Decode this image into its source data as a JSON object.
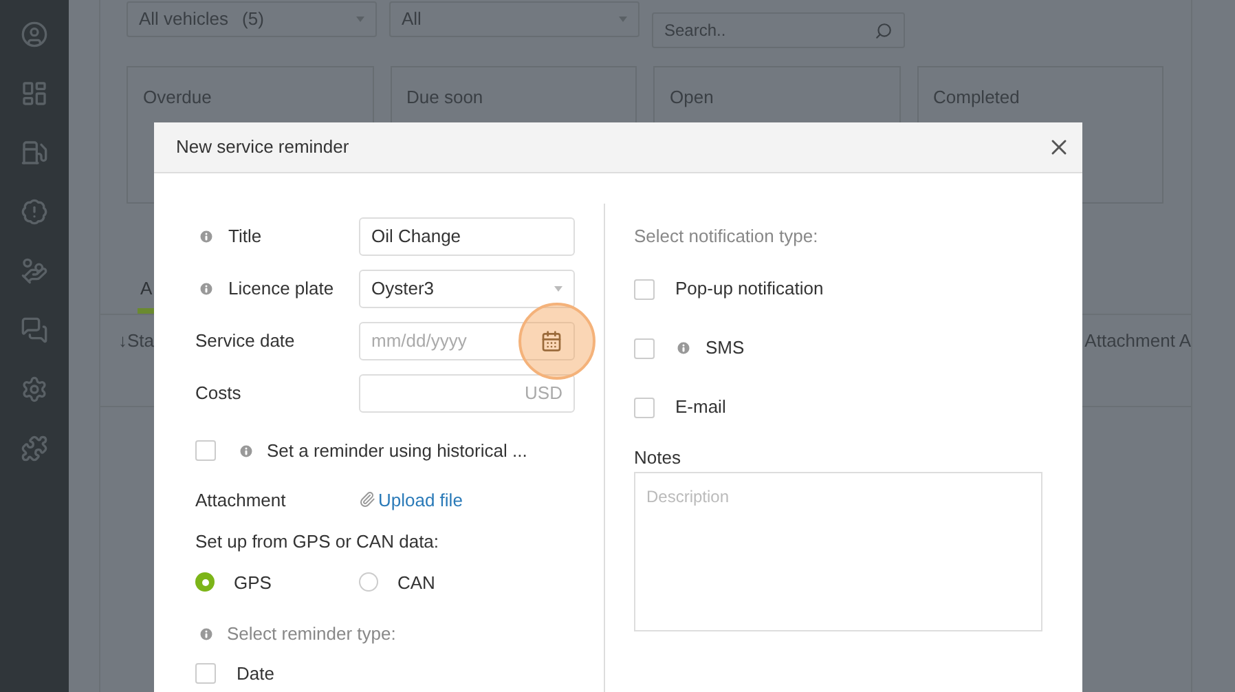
{
  "filters": [
    {
      "kind": "select",
      "value": "All vehicles",
      "count": "(5)"
    },
    {
      "kind": "select",
      "value": "All"
    },
    {
      "kind": "search",
      "placeholder": "Search.."
    }
  ],
  "cards": [
    {
      "title": "Overdue"
    },
    {
      "title": "Due soon"
    },
    {
      "title": "Open"
    },
    {
      "title": "Completed"
    }
  ],
  "tabs": [
    {
      "label": "A",
      "selected": true
    }
  ],
  "table": {
    "columns": [
      "↓Sta",
      "Attachment A"
    ]
  },
  "modal": {
    "title": "New service reminder",
    "fields": [
      {
        "kind": "text",
        "label": "Title",
        "info": true,
        "value": "Oil Change"
      },
      {
        "kind": "select",
        "label": "Licence plate",
        "info": true,
        "value": "Oyster3"
      },
      {
        "kind": "date",
        "label": "Service date",
        "info": false,
        "placeholder": "mm/dd/yyyy"
      },
      {
        "kind": "money",
        "label": "Costs",
        "info": false,
        "suffix": "USD"
      }
    ],
    "historical": {
      "label": "Set a reminder using historical ...",
      "checked": false
    },
    "attachment": {
      "label": "Attachment",
      "link": "Upload file"
    },
    "source": {
      "label": "Set up from GPS or CAN data:",
      "options": [
        {
          "label": "GPS",
          "selected": true
        },
        {
          "label": "CAN",
          "selected": false
        }
      ]
    },
    "reminder_type": {
      "label": "Select reminder type:",
      "options": [
        {
          "label": "Date",
          "checked": false
        }
      ]
    },
    "notification": {
      "label": "Select notification type:",
      "options": [
        {
          "label": "Pop-up notification",
          "info": false,
          "checked": false
        },
        {
          "label": "SMS",
          "info": true,
          "checked": false
        },
        {
          "label": "E-mail",
          "info": false,
          "checked": false
        }
      ]
    },
    "notes": {
      "label": "Notes",
      "placeholder": "Description"
    }
  }
}
